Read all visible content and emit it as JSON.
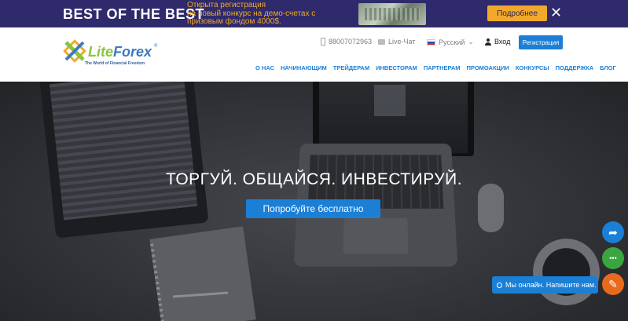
{
  "promo": {
    "title": "BEST OF THE BEST",
    "text_line1": "Открыта регистрация",
    "text_line2": "на новый конкурс на демо-счетах с",
    "text_line3": "призовым фондом 4000$.",
    "button": "Подробнее",
    "close_glyph": "✕",
    "accent_color": "#f2a92b",
    "bg_color": "#2e2a6b"
  },
  "header": {
    "logo_lite": "Lite",
    "logo_forex": "Forex",
    "logo_tagline": "The World of Financial Freedom",
    "logo_reg": "®",
    "phone": "88007072963",
    "live_chat": "Live-Чат",
    "language": "Русский",
    "language_chevron": "⌄",
    "login": "Вход",
    "register": "Регистрация"
  },
  "nav": {
    "items": [
      "О НАС",
      "НАЧИНАЮЩИМ",
      "ТРЕЙДЕРАМ",
      "ИНВЕСТОРАМ",
      "ПАРТНЕРАМ",
      "ПРОМОАКЦИИ",
      "КОНКУРСЫ",
      "ПОДДЕРЖКА",
      "БЛОГ"
    ]
  },
  "hero": {
    "title": "ТОРГУЙ. ОБЩАЙСЯ. ИНВЕСТИРУЙ.",
    "cta": "Попробуйте бесплатно"
  },
  "widgets": {
    "share_glyph": "➦",
    "chat_glyph": "•••",
    "edit_glyph": "✎",
    "chat_status": "Мы онлайн. Напишите нам."
  },
  "colors": {
    "primary": "#1b7fd6",
    "green": "#3aa640",
    "orange": "#e86a1c"
  }
}
